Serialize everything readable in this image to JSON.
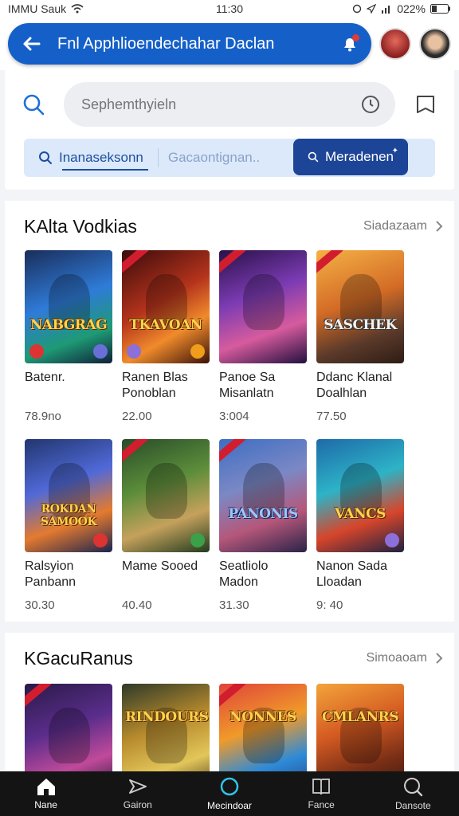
{
  "status_bar": {
    "carrier": "IMMU Sauk",
    "time": "11:30",
    "battery": "022%"
  },
  "header": {
    "title": "Fnl Apphlioendechahar Daclan"
  },
  "search": {
    "placeholder": "Sephemthyieln"
  },
  "segments": {
    "tab1": "Inanaseksonn",
    "tab2": "Gacaontignan..",
    "tab3": "Meradenen"
  },
  "section1": {
    "title": "KAlta Vodkias",
    "see_all": "Siadazaam",
    "items": [
      {
        "cover_title": "NABGRAG",
        "name": "Batenr.",
        "price": "78.9no"
      },
      {
        "cover_title": "TKAVOAN",
        "name": "Ranen Blas Ponoblan",
        "price": "22.00"
      },
      {
        "cover_title": "",
        "name": "Panoe Sa Misanlatn",
        "price": "3:004"
      },
      {
        "cover_title": "SASCHEK",
        "name": "Ddanc Klanal Doalhlan",
        "price": "77.50"
      },
      {
        "cover_title": "ROKDAN SAMOOK",
        "name": "Ralsyion Panbann",
        "price": "30.30"
      },
      {
        "cover_title": "",
        "name": "Mame Sooed",
        "price": "40.40"
      },
      {
        "cover_title": "PANONIS",
        "name": "Seatliolo Madon",
        "price": "31.30"
      },
      {
        "cover_title": "VANCS",
        "name": "Nanon Sada Lloadan",
        "price": "9: 40"
      }
    ]
  },
  "section2": {
    "title": "KGacuRanus",
    "see_all": "Simoaoam",
    "items": [
      {
        "cover_title": ""
      },
      {
        "cover_title": "RINDOURS"
      },
      {
        "cover_title": "NONNES"
      },
      {
        "cover_title": "CMLANRS"
      }
    ]
  },
  "bottom_nav": [
    {
      "label": "Nane",
      "icon": "home-icon"
    },
    {
      "label": "Gairon",
      "icon": "send-icon"
    },
    {
      "label": "Mecindoar",
      "icon": "circle-icon"
    },
    {
      "label": "Fance",
      "icon": "book-icon"
    },
    {
      "label": "Dansote",
      "icon": "search-icon"
    }
  ],
  "colors": {
    "header_pill": "#1560c8",
    "segment_bg": "#dce9fb",
    "segment_active": "#1d4597",
    "bottom_nav_bg": "#141414"
  }
}
